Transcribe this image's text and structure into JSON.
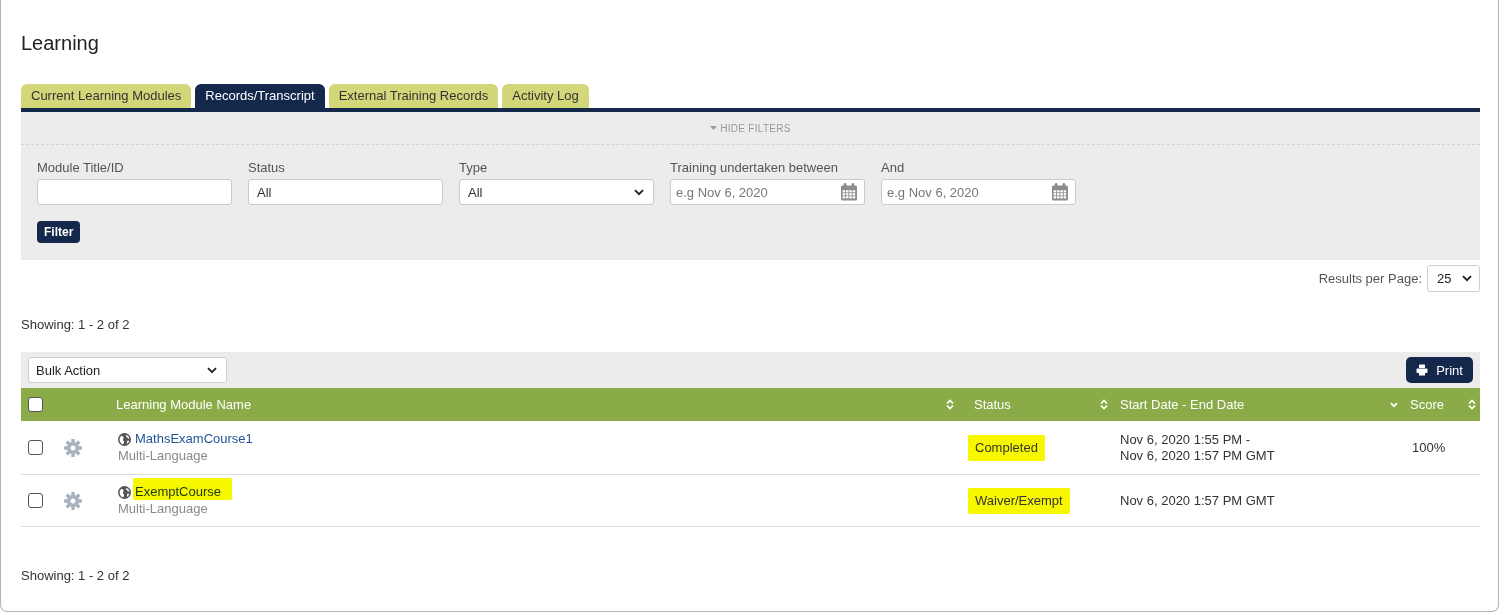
{
  "page": {
    "title": "Learning"
  },
  "tabs": [
    {
      "label": "Current Learning Modules",
      "selected": false
    },
    {
      "label": "Records/Transcript",
      "selected": true
    },
    {
      "label": "External Training Records",
      "selected": false
    },
    {
      "label": "Activity Log",
      "selected": false
    }
  ],
  "filters": {
    "toggle": "HIDE FILTERS",
    "fields": [
      {
        "kind": "text",
        "label": "Module Title/ID"
      },
      {
        "kind": "text",
        "label": "Status",
        "value": "All"
      },
      {
        "kind": "select",
        "label": "Type",
        "value": "All"
      },
      {
        "kind": "date",
        "label": "Training undertaken between",
        "placeholder": "e.g Nov 6, 2020"
      },
      {
        "kind": "date",
        "label": "And",
        "placeholder": "e.g Nov 6, 2020"
      }
    ],
    "button": "Filter"
  },
  "results_per_page": {
    "label": "Results per Page:",
    "value": "25"
  },
  "showing_top": "Showing: 1 - 2 of 2",
  "toolbar": {
    "bulk_action": "Bulk Action",
    "print": "Print"
  },
  "table": {
    "select_all_checked": false,
    "columns": [
      {
        "label": "Learning Module Name",
        "sorted_descending": false
      },
      {
        "label": "Status",
        "sorted_descending": false
      },
      {
        "label": "Start Date - End Date",
        "sorted_descending": true
      },
      {
        "label": "Score",
        "sorted_descending": false
      }
    ],
    "rows": [
      {
        "checked": false,
        "name": "MathsExamCourse1",
        "name_highlighted": false,
        "language": "Multi-Language",
        "status": "Completed",
        "status_highlighted": true,
        "dates": [
          "Nov 6, 2020 1:55 PM -",
          "Nov 6, 2020 1:57 PM GMT"
        ],
        "score": "100%"
      },
      {
        "checked": false,
        "name": "ExemptCourse",
        "name_highlighted": true,
        "language": "Multi-Language",
        "status": "Waiver/Exempt",
        "status_highlighted": true,
        "dates": [
          "Nov 6, 2020 1:57 PM GMT"
        ]
      }
    ]
  },
  "showing_bottom": "Showing: 1 - 2 of 2"
}
